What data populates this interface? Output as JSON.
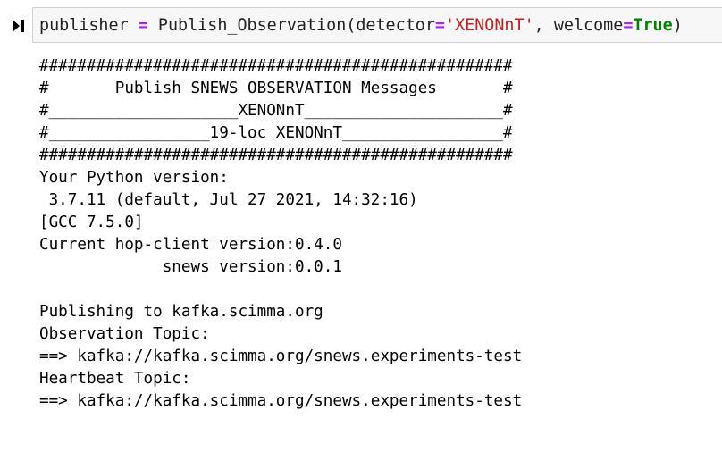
{
  "cell": {
    "input": {
      "var_name": "publisher",
      "assign_op": "=",
      "func_name": "Publish_Observation",
      "open_paren": "(",
      "arg1_name": "detector",
      "arg1_eq": "=",
      "arg1_value": "'XENONnT'",
      "separator": ",",
      "arg2_name": "welcome",
      "arg2_eq": "=",
      "arg2_value": "True",
      "close_paren": ")"
    },
    "output_lines": [
      "##################################################",
      "#       Publish SNEWS OBSERVATION Messages       #",
      "#____________________XENONnT_____________________#",
      "#_________________19-loc XENONnT_________________#",
      "##################################################",
      "Your Python version:",
      " 3.7.11 (default, Jul 27 2021, 14:32:16) ",
      "[GCC 7.5.0]",
      "Current hop-client version:0.4.0",
      "             snews version:0.0.1",
      "",
      "Publishing to kafka.scimma.org",
      "Observation Topic:",
      "==> kafka://kafka.scimma.org/snews.experiments-test",
      "Heartbeat Topic:",
      "==> kafka://kafka.scimma.org/snews.experiments-test"
    ]
  },
  "icons": {
    "run": "run-cell-icon"
  },
  "colors": {
    "keyword": "#008000",
    "string": "#ba2121",
    "operator": "#aa22ff",
    "cell_border": "#cfcfcf",
    "cell_background": "#f7f7f7"
  }
}
